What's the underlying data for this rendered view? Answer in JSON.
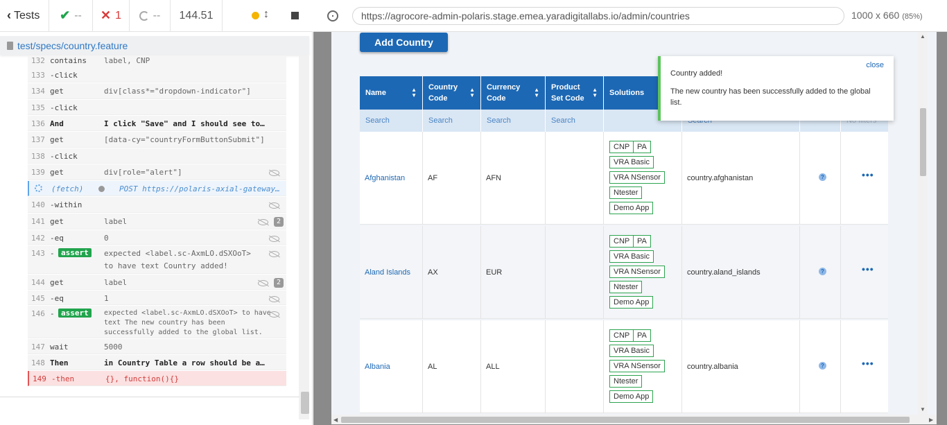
{
  "runner": {
    "tests_label": "Tests",
    "passed": "--",
    "failed": "1",
    "pending": "--",
    "duration": "144.51",
    "spec_file": "test/specs/country.feature"
  },
  "commands": [
    {
      "num": "132",
      "name": "contains",
      "msg": "label, CNP"
    },
    {
      "num": "133",
      "name": "-click",
      "msg": ""
    },
    {
      "num": "134",
      "name": "get",
      "msg": "div[class*=\"dropdown-indicator\"]"
    },
    {
      "num": "135",
      "name": "-click",
      "msg": ""
    },
    {
      "num": "136",
      "name": "And",
      "msg": "I click \"Save\" and I should see tooltip text..."
    },
    {
      "num": "137",
      "name": "get",
      "msg": "[data-cy=\"countryFormButtonSubmit\"]"
    },
    {
      "num": "138",
      "name": "-click",
      "msg": ""
    },
    {
      "num": "139",
      "name": "get",
      "msg": "div[role=\"alert\"]"
    },
    {
      "num": "",
      "name": "(fetch)",
      "msg": "POST https://polaris-axial-gateway..."
    },
    {
      "num": "140",
      "name": "-within",
      "msg": ""
    },
    {
      "num": "141",
      "name": "get",
      "msg": "label",
      "count": "2"
    },
    {
      "num": "142",
      "name": "-eq",
      "msg": "0"
    },
    {
      "num": "143",
      "name": "-",
      "badge": "assert",
      "msg_a": "expected  <label.sc-AxmLO.dSXOoT>",
      "msg_b": "to have text  Country added!"
    },
    {
      "num": "144",
      "name": "get",
      "msg": "label",
      "count": "2"
    },
    {
      "num": "145",
      "name": "-eq",
      "msg": "1"
    },
    {
      "num": "146",
      "name": "-",
      "badge": "assert",
      "msg_a": "expected  <label.sc-AxmLO.dSXOoT>  to have",
      "msg_b": "text  The new country has been",
      "msg_c": "successfully added to the global list."
    },
    {
      "num": "147",
      "name": "wait",
      "msg": "5000"
    },
    {
      "num": "148",
      "name": "Then",
      "msg": "in Country Table a row should be adde..."
    },
    {
      "num": "149",
      "name": "-then",
      "msg": "{}, function(){}"
    }
  ],
  "browser": {
    "url": "https://agrocore-admin-polaris.stage.emea.yaradigitallabs.io/admin/countries",
    "viewport": "1000 x 660",
    "zoom": "(85%)"
  },
  "app": {
    "add_button": "Add Country",
    "headers": {
      "name": "Name",
      "country_code_1": "Country",
      "country_code_2": "Code",
      "currency_code_1": "Currency",
      "currency_code_2": "Code",
      "product_set_1": "Product",
      "product_set_2": "Set Code",
      "solutions": "Solutions"
    },
    "search_placeholder": "Search",
    "search_partial": "Search",
    "no_filters": "No filters",
    "rows": [
      {
        "name": "Afghanistan",
        "code": "AF",
        "currency": "AFN",
        "key": "country.afghanistan"
      },
      {
        "name": "Aland Islands",
        "code": "AX",
        "currency": "EUR",
        "key": "country.aland_islands"
      },
      {
        "name": "Albania",
        "code": "AL",
        "currency": "ALL",
        "key": "country.albania"
      }
    ],
    "solutions": [
      "CNP",
      "PA",
      "VRA Basic",
      "VRA NSensor",
      "Ntester",
      "Demo App"
    ],
    "toast": {
      "title": "Country added!",
      "message": "The new country has been successfully added to the global list.",
      "close": "close"
    }
  },
  "colors": {
    "brand_blue": "#1d68b4",
    "pass_green": "#21a44d",
    "fail_red": "#d83b3b"
  }
}
